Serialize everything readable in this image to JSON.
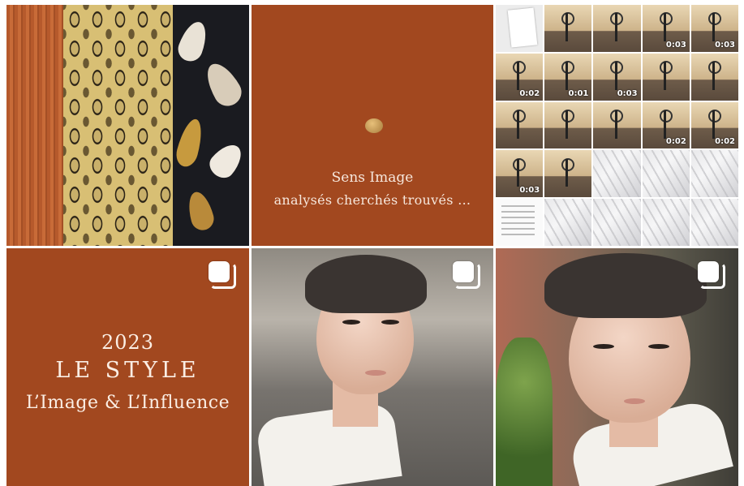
{
  "grid": {
    "tiles": [
      {
        "id": "fabric-photo",
        "kind": "photo"
      },
      {
        "id": "sens-image",
        "kind": "text",
        "line1": "Sens Image",
        "line2": "analysés cherchés trouvés …"
      },
      {
        "id": "thumb-collage",
        "kind": "collage",
        "durations": [
          "0:03",
          "0:03",
          "0:02",
          "0:01",
          "0:03",
          "0:02",
          "0:02",
          "0:03"
        ]
      },
      {
        "id": "le-style",
        "kind": "text",
        "year": "2023",
        "title": "LE STYLE",
        "subtitle": "L’Image & L’Influence",
        "multi_icon": "carousel-icon"
      },
      {
        "id": "portrait-1",
        "kind": "photo",
        "multi_icon": "carousel-icon"
      },
      {
        "id": "portrait-2",
        "kind": "photo",
        "multi_icon": "carousel-icon"
      }
    ]
  },
  "colors": {
    "brand": "#a2481f",
    "text_light": "#fbeee4"
  }
}
